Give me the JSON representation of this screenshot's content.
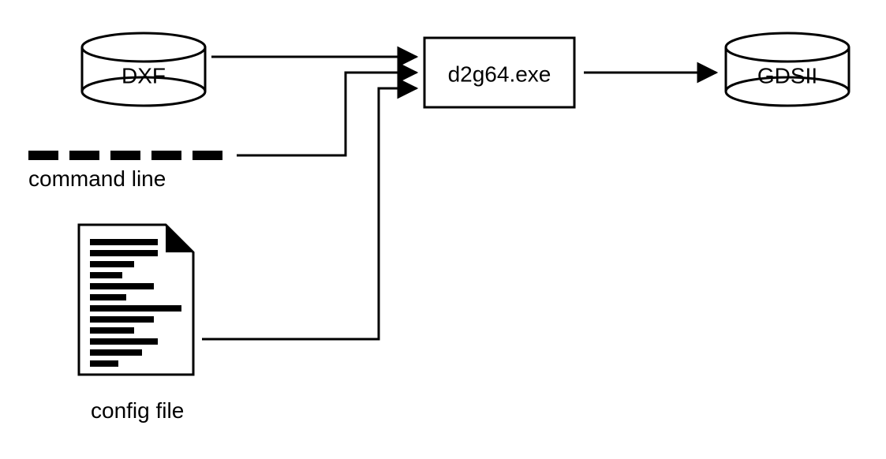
{
  "nodes": {
    "dxf": {
      "label": "DXF"
    },
    "cmdline": {
      "label": "command line"
    },
    "config": {
      "label": "config file"
    },
    "process": {
      "label": "d2g64.exe"
    },
    "gdsii": {
      "label": "GDSII"
    }
  }
}
